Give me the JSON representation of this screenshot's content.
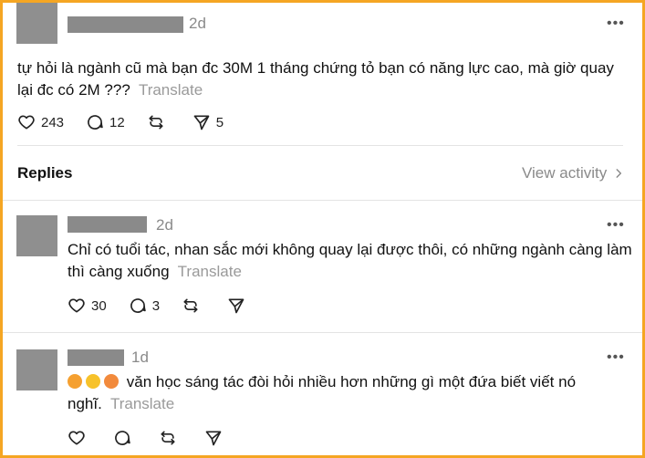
{
  "post": {
    "time": "2d",
    "text_line1": "tự hỏi là ngành cũ mà bạn đc 30M 1 tháng chứng tỏ bạn có năng lực cao, mà giờ quay",
    "text_line2": "lại đc có 2M ???",
    "translate": "Translate",
    "likes": "243",
    "comments": "12",
    "shares": "5"
  },
  "replies_header": {
    "title": "Replies",
    "view_activity": "View activity"
  },
  "replies": [
    {
      "time": "2d",
      "text_line1": "Chỉ có tuổi tác, nhan sắc mới không quay lại được thôi, có những ngành càng làm",
      "text_line2": "thì càng xuống",
      "translate": "Translate",
      "likes": "30",
      "comments": "3"
    },
    {
      "time": "1d",
      "text_line1": "văn học sáng tác đòi hỏi nhiều hơn những gì một đứa biết viết nó",
      "text_line2": "nghĩ.",
      "translate": "Translate"
    }
  ],
  "colors": {
    "border": "#f5a623",
    "muted": "#8a8a8a",
    "text": "#111111"
  }
}
